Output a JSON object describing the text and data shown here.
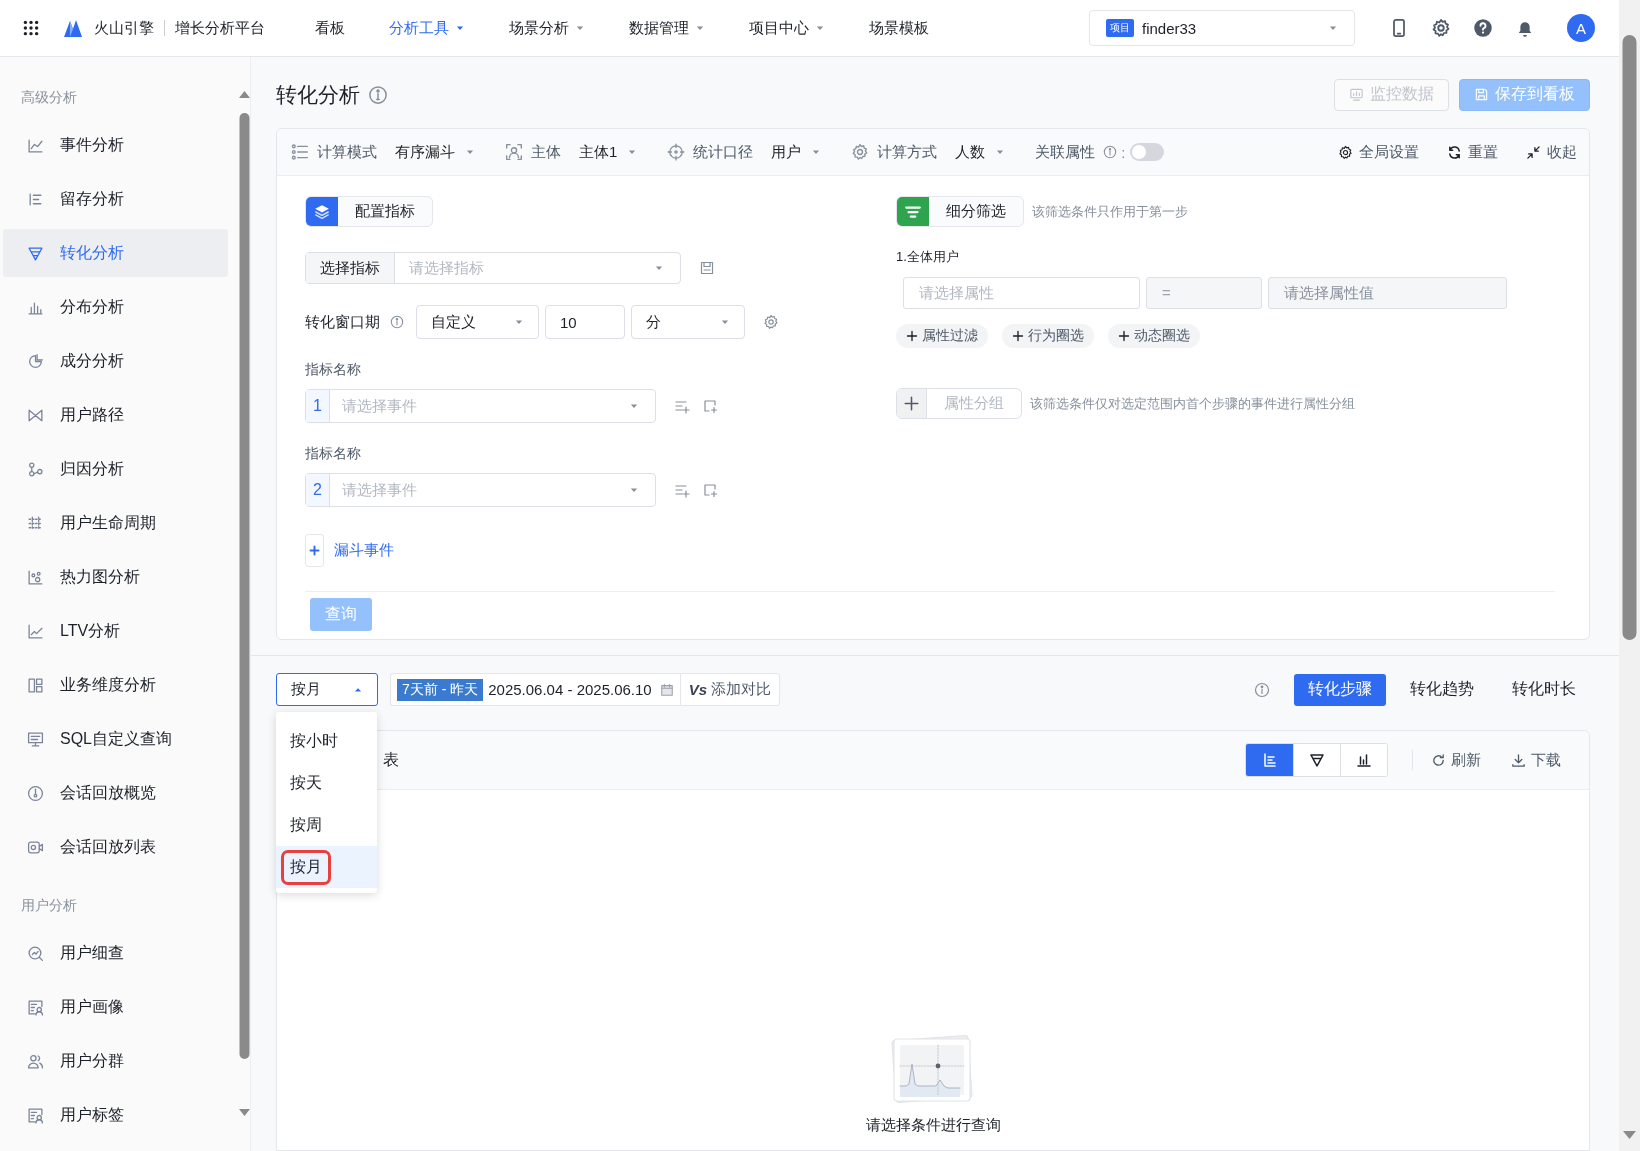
{
  "topbar": {
    "brand": "火山引擎",
    "product": "增长分析平台",
    "nav": [
      {
        "label": "看板",
        "selected": false,
        "dropdown": false
      },
      {
        "label": "分析工具",
        "selected": true,
        "dropdown": true
      },
      {
        "label": "场景分析",
        "selected": false,
        "dropdown": true
      },
      {
        "label": "数据管理",
        "selected": false,
        "dropdown": true
      },
      {
        "label": "项目中心",
        "selected": false,
        "dropdown": true
      },
      {
        "label": "场景模板",
        "selected": false,
        "dropdown": false
      }
    ],
    "project": {
      "badge": "项目",
      "name": "finder33"
    },
    "avatar": "A"
  },
  "sidebar": {
    "groups": [
      {
        "title": "高级分析",
        "items": [
          {
            "label": "事件分析",
            "selected": false
          },
          {
            "label": "留存分析",
            "selected": false
          },
          {
            "label": "转化分析",
            "selected": true
          },
          {
            "label": "分布分析",
            "selected": false
          },
          {
            "label": "成分分析",
            "selected": false
          },
          {
            "label": "用户路径",
            "selected": false
          },
          {
            "label": "归因分析",
            "selected": false
          },
          {
            "label": "用户生命周期",
            "selected": false
          },
          {
            "label": "热力图分析",
            "selected": false
          },
          {
            "label": "LTV分析",
            "selected": false
          },
          {
            "label": "业务维度分析",
            "selected": false
          },
          {
            "label": "SQL自定义查询",
            "selected": false
          },
          {
            "label": "会话回放概览",
            "selected": false
          },
          {
            "label": "会话回放列表",
            "selected": false
          }
        ]
      },
      {
        "title": "用户分析",
        "items": [
          {
            "label": "用户细查",
            "selected": false
          },
          {
            "label": "用户画像",
            "selected": false
          },
          {
            "label": "用户分群",
            "selected": false
          },
          {
            "label": "用户标签",
            "selected": false
          }
        ]
      }
    ]
  },
  "page": {
    "title": "转化分析",
    "actions": [
      {
        "label": "监控数据",
        "kind": "secondary"
      },
      {
        "label": "保存到看板",
        "kind": "primary"
      }
    ]
  },
  "config": {
    "settings": [
      {
        "label": "计算模式",
        "value": "有序漏斗"
      },
      {
        "label": "主体",
        "value": "主体1"
      },
      {
        "label": "统计口径",
        "value": "用户"
      },
      {
        "label": "计算方式",
        "value": "人数"
      }
    ],
    "link": {
      "label": "关联属性",
      "separator": ":",
      "on": false
    },
    "tools": [
      "全局设置",
      "重置",
      "收起"
    ],
    "metrics": {
      "title": "配置指标",
      "selector": {
        "label": "选择指标",
        "placeholder": "请选择指标"
      },
      "window": {
        "label": "转化窗口期",
        "mode": "自定义",
        "amount": "10",
        "unit": "分"
      },
      "steps": [
        {
          "label": "指标名称",
          "number": "1",
          "placeholder": "请选择事件"
        },
        {
          "label": "指标名称",
          "number": "2",
          "placeholder": "请选择事件"
        }
      ],
      "add": "漏斗事件"
    },
    "filters": {
      "title": "细分筛选",
      "hint": "该筛选条件只作用于第一步",
      "group": "1.全体用户",
      "condition": {
        "property_placeholder": "请选择属性",
        "operator": "=",
        "value_placeholder": "请选择属性值"
      },
      "adders": [
        "属性过滤",
        "行为圈选",
        "动态圈选"
      ],
      "grouping": {
        "label": "属性分组",
        "hint": "该筛选条件仅对选定范围内首个步骤的事件进行属性分组"
      }
    },
    "query": {
      "label": "查询",
      "disabled": true
    }
  },
  "results": {
    "granularity": {
      "value": "按月",
      "expanded": true,
      "options": [
        {
          "label": "按小时",
          "selected": false
        },
        {
          "label": "按天",
          "selected": false
        },
        {
          "label": "按周",
          "selected": false
        },
        {
          "label": "按月",
          "selected": true
        }
      ]
    },
    "range": {
      "preset": "7天前 - 昨天",
      "dates": "2025.06.04 - 2025.06.10"
    },
    "compare": {
      "mark": "Vs",
      "label": "添加对比"
    },
    "tabs": [
      {
        "label": "转化步骤",
        "selected": true
      },
      {
        "label": "转化趋势",
        "selected": false
      },
      {
        "label": "转化时长",
        "selected": false
      }
    ],
    "panel": {
      "title": "表",
      "views": [
        {
          "selected": true
        },
        {
          "selected": false
        },
        {
          "selected": false
        }
      ],
      "actions": [
        "刷新",
        "下载"
      ],
      "empty": "请选择条件进行查询"
    }
  }
}
